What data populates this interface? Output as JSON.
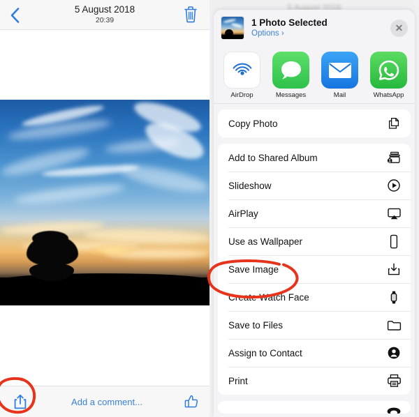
{
  "left_panel": {
    "header": {
      "back_icon": "back-chevron-icon",
      "date": "5 August 2018",
      "time": "20:39",
      "delete_icon": "trash-icon"
    },
    "photo": {
      "description": "Sunset landscape with silhouetted lone tree under blue sky with cirrus clouds"
    },
    "bottom_bar": {
      "share_icon": "share-icon",
      "comment_placeholder": "Add a comment...",
      "like_icon": "thumbs-up-icon"
    }
  },
  "right_panel": {
    "ghost_header_date": "5 August 2018",
    "sheet_header": {
      "title": "1 Photo Selected",
      "options_label": "Options ›",
      "close_icon": "close-icon",
      "thumbnail_name": "photo-thumbnail"
    },
    "apps": [
      {
        "label": "AirDrop",
        "icon": "airdrop-icon"
      },
      {
        "label": "Messages",
        "icon": "messages-icon"
      },
      {
        "label": "Mail",
        "icon": "mail-icon"
      },
      {
        "label": "WhatsApp",
        "icon": "whatsapp-icon"
      },
      {
        "label": "",
        "icon": "notes-icon"
      }
    ],
    "action_cards": [
      {
        "rows": [
          {
            "label": "Copy Photo",
            "icon": "copy-icon"
          }
        ]
      },
      {
        "rows": [
          {
            "label": "Add to Shared Album",
            "icon": "shared-album-icon"
          },
          {
            "label": "Slideshow",
            "icon": "play-circle-icon"
          },
          {
            "label": "AirPlay",
            "icon": "airplay-icon"
          },
          {
            "label": "Use as Wallpaper",
            "icon": "phone-icon"
          },
          {
            "label": "Save Image",
            "icon": "save-download-icon"
          },
          {
            "label": "Create Watch Face",
            "icon": "watch-icon"
          },
          {
            "label": "Save to Files",
            "icon": "folder-icon"
          },
          {
            "label": "Assign to Contact",
            "icon": "contact-icon"
          },
          {
            "label": "Print",
            "icon": "printer-icon"
          }
        ]
      }
    ]
  },
  "annotations": {
    "color": "#E8331C",
    "save_image_circle": "red-ellipse-around-save-image",
    "share_button_circle": "red-ellipse-around-share-button"
  }
}
